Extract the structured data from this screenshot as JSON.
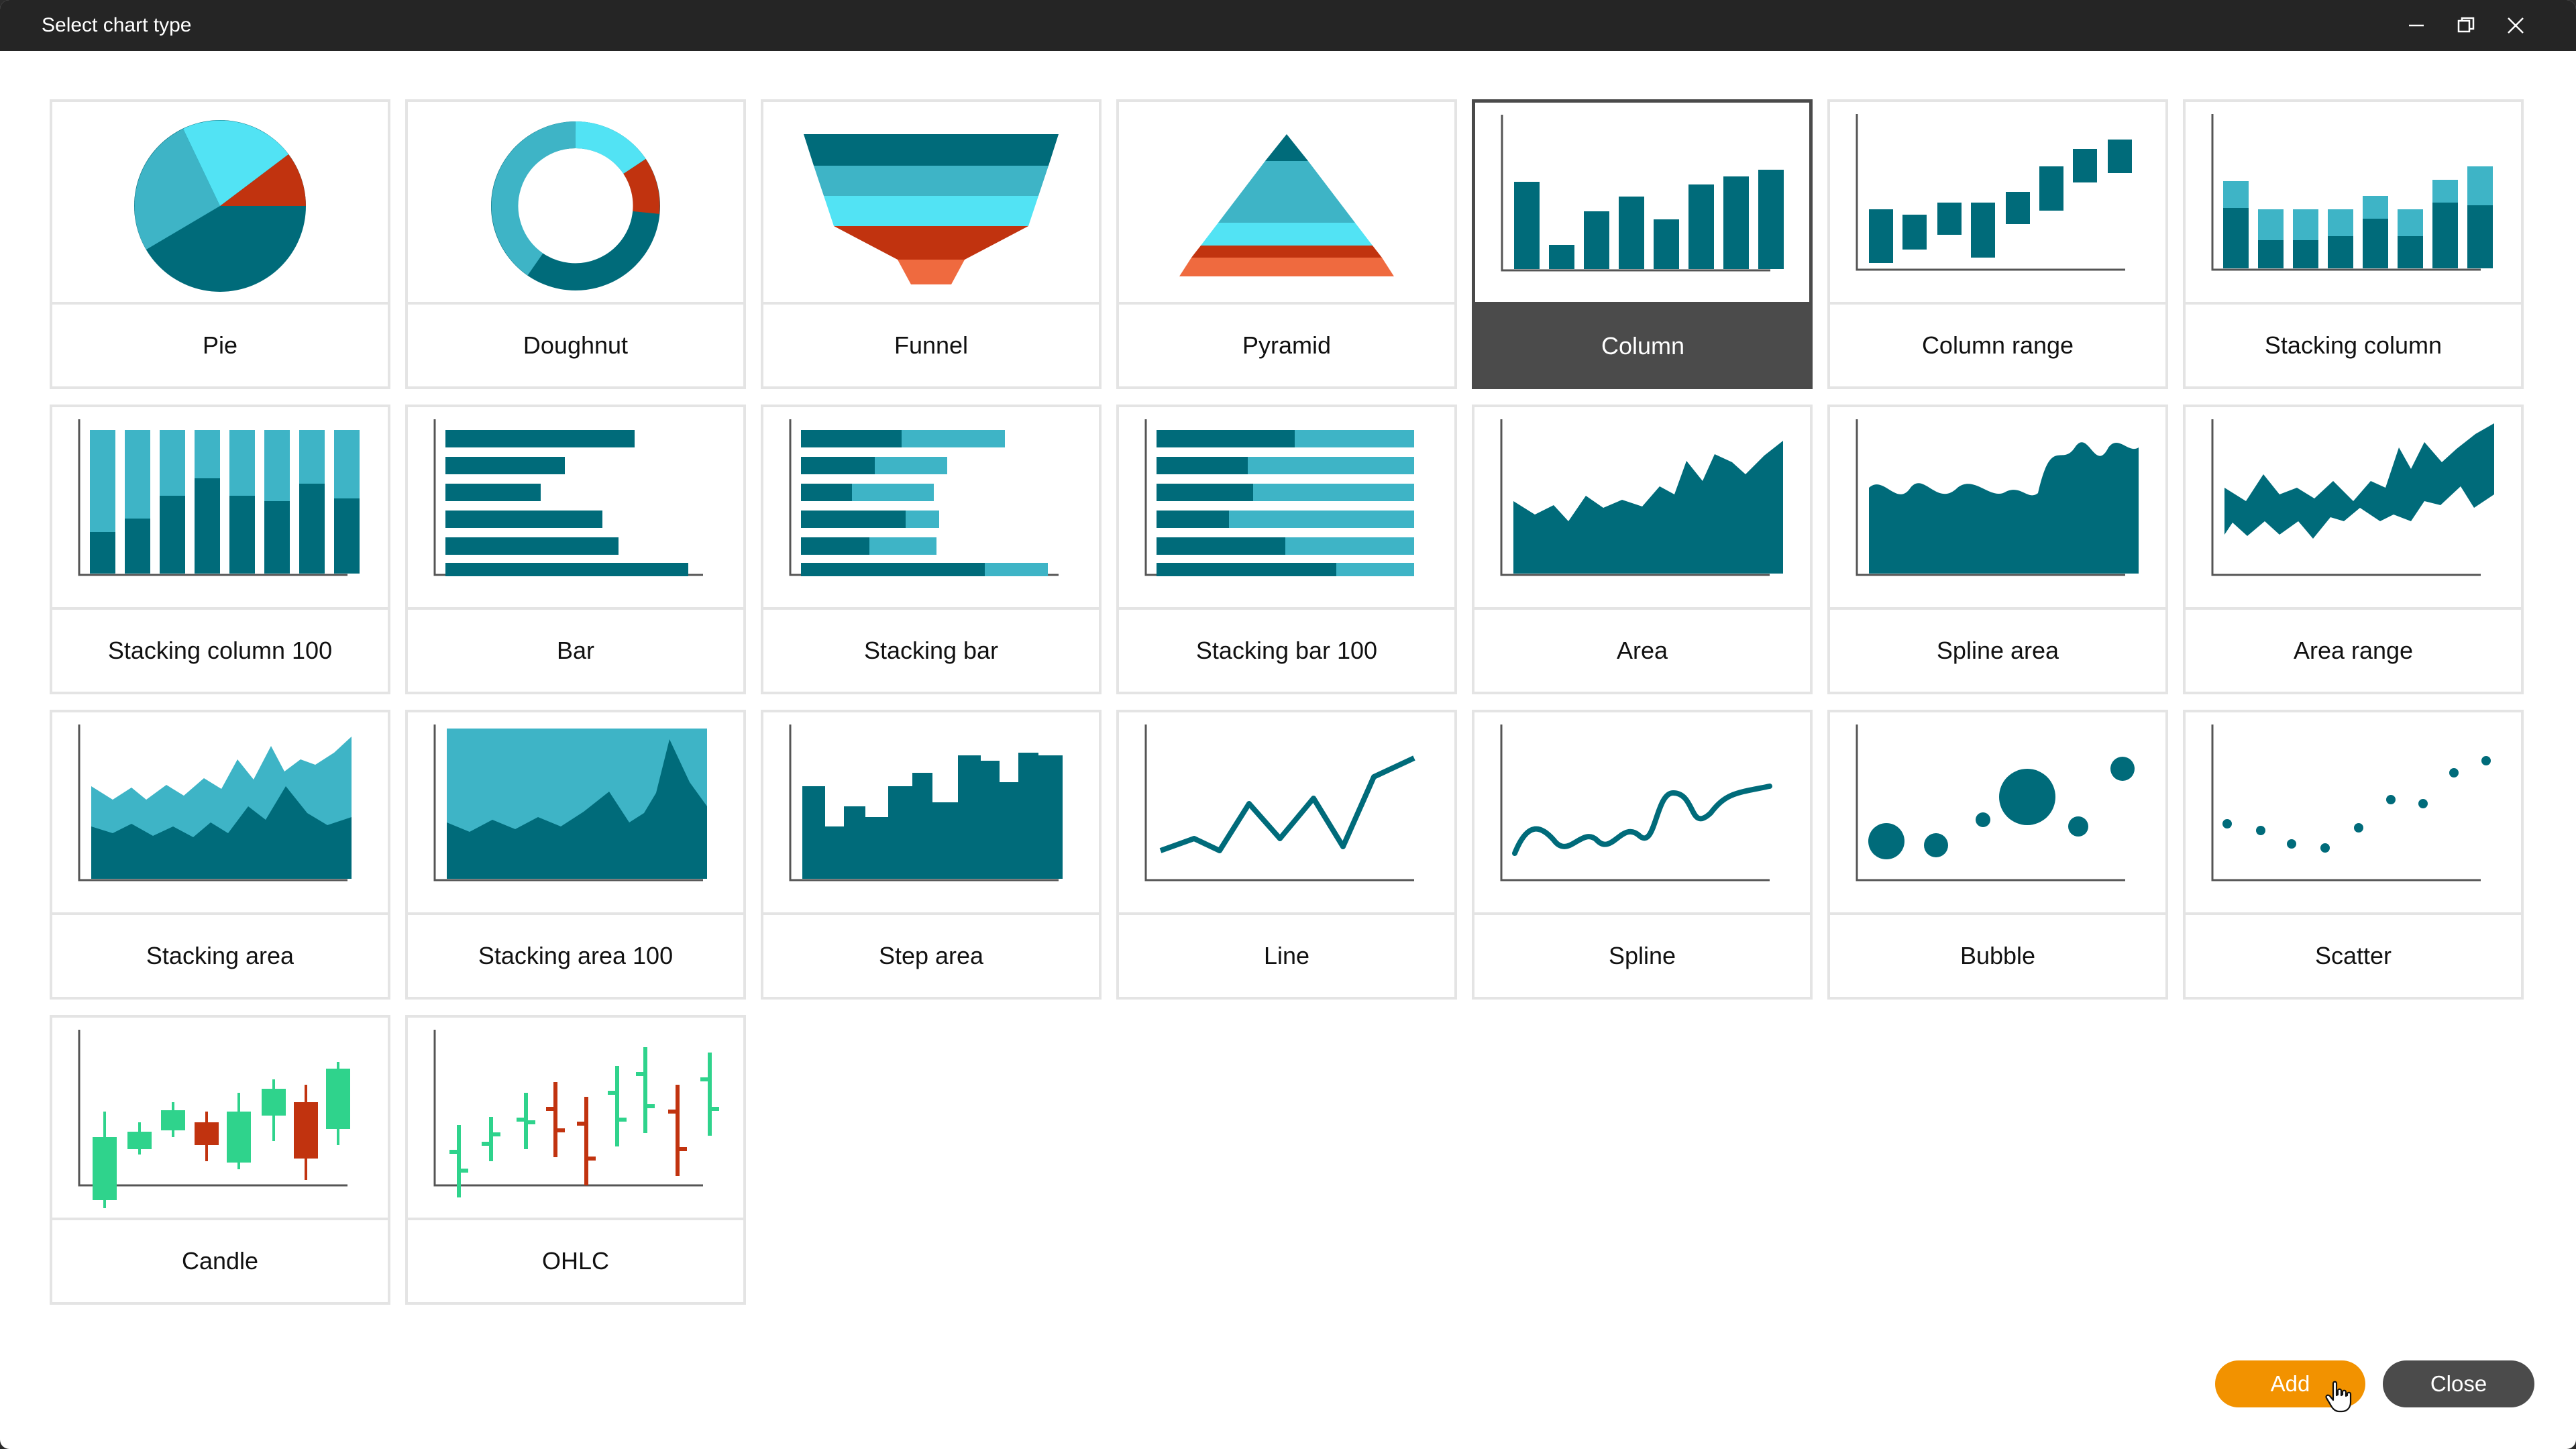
{
  "window": {
    "title": "Select chart type",
    "controls": [
      "minimize-icon",
      "restore-icon",
      "close-icon"
    ]
  },
  "colors": {
    "dark": "#006b7a",
    "mid": "#3eb4c6",
    "light": "#52e3f4",
    "red": "#c1330f",
    "orange": "#ef6a3f",
    "green": "#2fd38c",
    "accent_button": "#f29200",
    "secondary_button": "#4b4b4b"
  },
  "chart_types": [
    {
      "label": "Pie",
      "icon": "pie-chart-icon"
    },
    {
      "label": "Doughnut",
      "icon": "doughnut-chart-icon"
    },
    {
      "label": "Funnel",
      "icon": "funnel-chart-icon"
    },
    {
      "label": "Pyramid",
      "icon": "pyramid-chart-icon"
    },
    {
      "label": "Column",
      "icon": "column-chart-icon",
      "selected": true
    },
    {
      "label": "Column range",
      "icon": "column-range-chart-icon"
    },
    {
      "label": "Stacking column",
      "icon": "stacking-column-chart-icon"
    },
    {
      "label": "Stacking column 100",
      "icon": "stacking-column-100-chart-icon"
    },
    {
      "label": "Bar",
      "icon": "bar-chart-icon"
    },
    {
      "label": "Stacking bar",
      "icon": "stacking-bar-chart-icon"
    },
    {
      "label": "Stacking bar 100",
      "icon": "stacking-bar-100-chart-icon"
    },
    {
      "label": "Area",
      "icon": "area-chart-icon"
    },
    {
      "label": "Spline area",
      "icon": "spline-area-chart-icon"
    },
    {
      "label": "Area range",
      "icon": "area-range-chart-icon"
    },
    {
      "label": "Stacking area",
      "icon": "stacking-area-chart-icon"
    },
    {
      "label": "Stacking area 100",
      "icon": "stacking-area-100-chart-icon"
    },
    {
      "label": "Step area",
      "icon": "step-area-chart-icon"
    },
    {
      "label": "Line",
      "icon": "line-chart-icon"
    },
    {
      "label": "Spline",
      "icon": "spline-chart-icon"
    },
    {
      "label": "Bubble",
      "icon": "bubble-chart-icon"
    },
    {
      "label": "Scatter",
      "icon": "scatter-chart-icon"
    },
    {
      "label": "Candle",
      "icon": "candle-chart-icon"
    },
    {
      "label": "OHLC",
      "icon": "ohlc-chart-icon"
    }
  ],
  "buttons": {
    "add": "Add",
    "close": "Close"
  }
}
